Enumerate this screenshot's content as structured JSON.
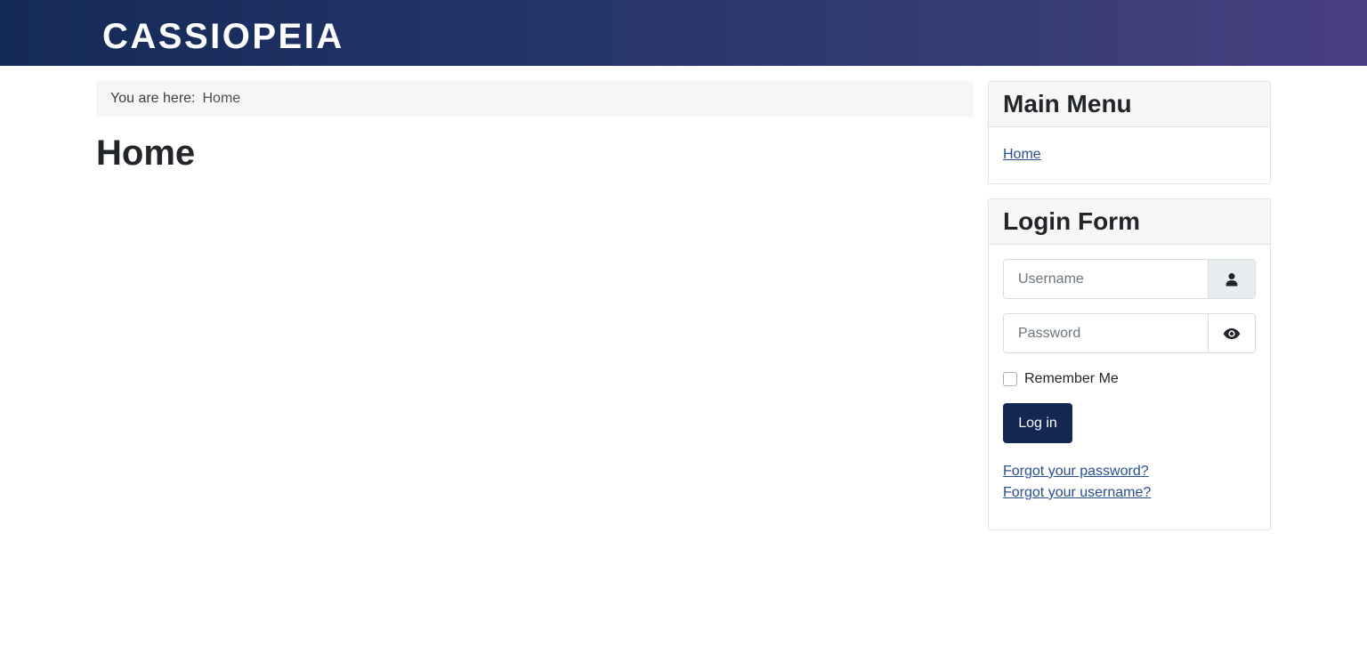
{
  "header": {
    "brand": "CASSIOPEIA"
  },
  "breadcrumb": {
    "prefix": "You are here:",
    "current": "Home"
  },
  "main": {
    "title": "Home"
  },
  "main_menu": {
    "title": "Main Menu",
    "items": [
      {
        "label": "Home"
      }
    ]
  },
  "login_form": {
    "title": "Login Form",
    "username_placeholder": "Username",
    "password_placeholder": "Password",
    "username_icon": "user-icon",
    "password_icon": "eye-icon",
    "remember_label": "Remember Me",
    "login_label": "Log in",
    "forgot_password": "Forgot your password?",
    "forgot_username": "Forgot your username?"
  },
  "colors": {
    "header_gradient_start": "#142a57",
    "header_gradient_end": "#493f80",
    "button": "#132750",
    "link": "#2a4f8f"
  }
}
